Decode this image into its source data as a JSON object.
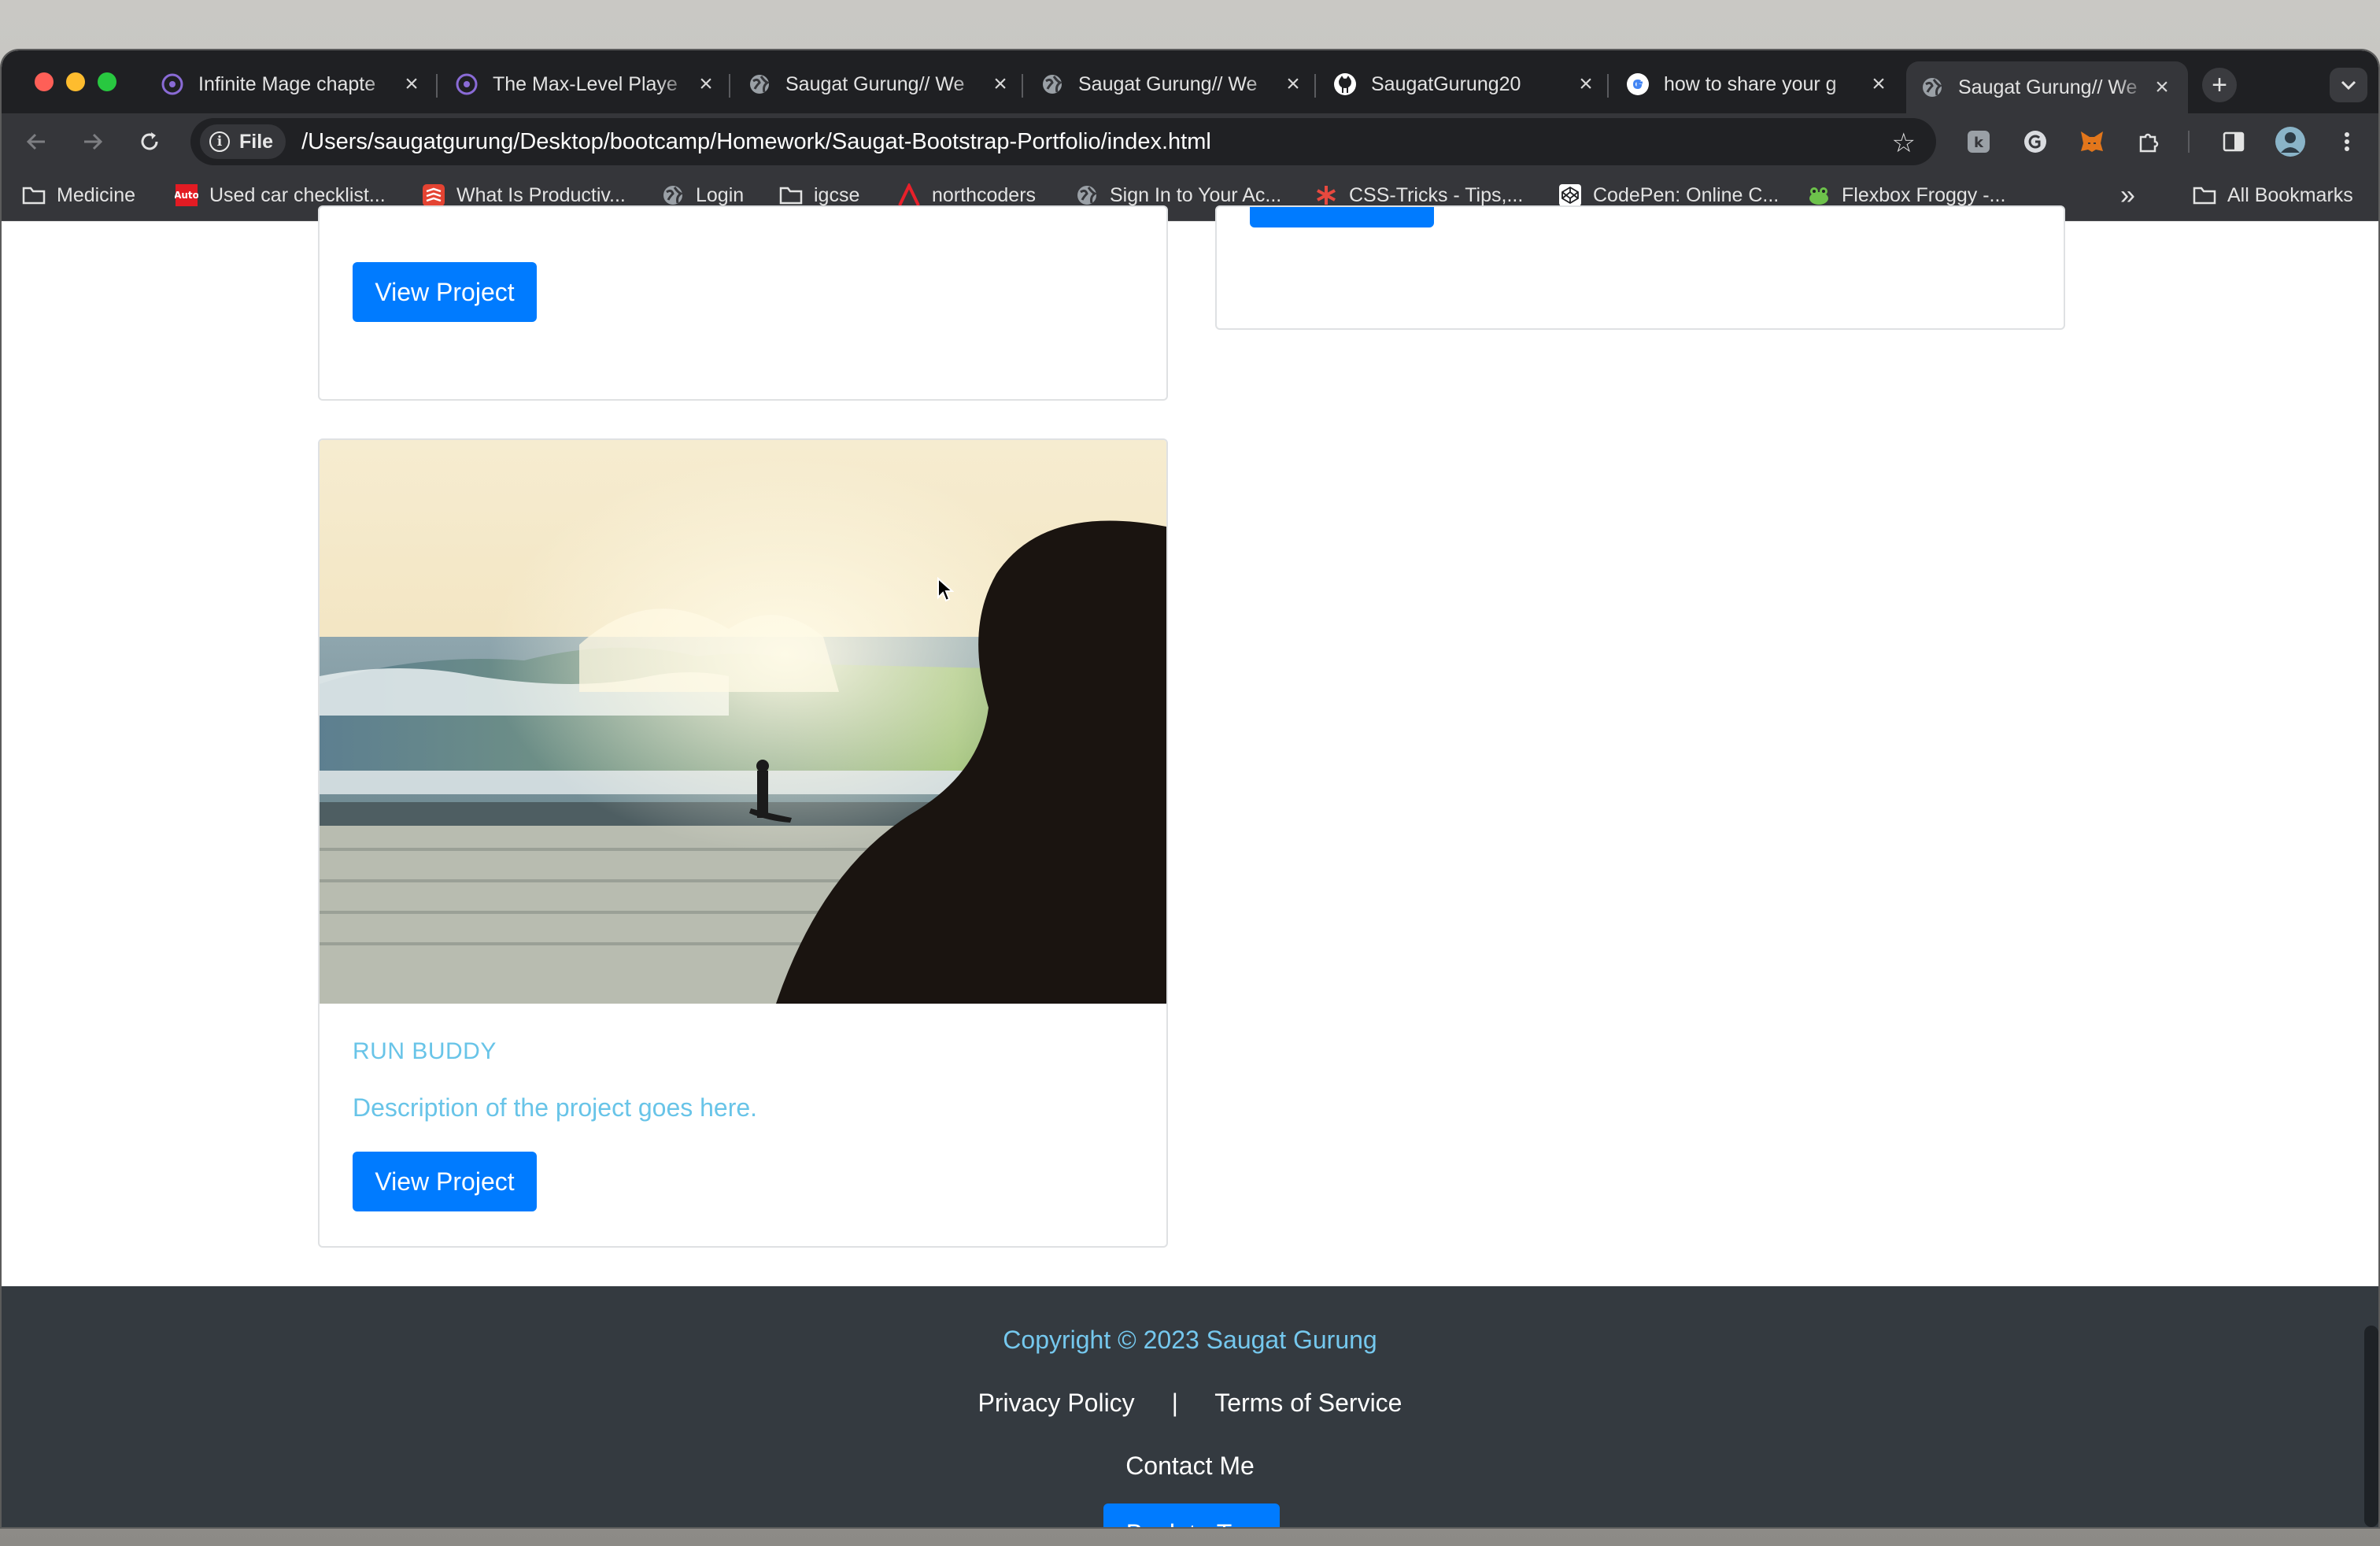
{
  "browser": {
    "tabs": [
      {
        "title": "Infinite Mage chapte",
        "icon": "mage-site-icon"
      },
      {
        "title": "The Max-Level Playe",
        "icon": "mage-site-icon"
      },
      {
        "title": "Saugat Gurung// We",
        "icon": "globe-icon"
      },
      {
        "title": "Saugat Gurung// We",
        "icon": "globe-icon"
      },
      {
        "title": "SaugatGurung20",
        "icon": "github-icon"
      },
      {
        "title": "how to share your g",
        "icon": "google-icon"
      },
      {
        "title": "Saugat Gurung// We",
        "icon": "globe-icon",
        "active": true
      }
    ],
    "new_tab_label": "+",
    "omnibox": {
      "chip_label": "File",
      "url": "/Users/saugatgurung/Desktop/bootcamp/Homework/Saugat-Bootstrap-Portfolio/index.html"
    },
    "bookmarks": [
      {
        "label": "Medicine",
        "icon": "folder-icon"
      },
      {
        "label": "Used car checklist...",
        "icon": "autoexpress-icon"
      },
      {
        "label": "What Is Productiv...",
        "icon": "todoist-icon"
      },
      {
        "label": "Login",
        "icon": "globe-icon"
      },
      {
        "label": "igcse",
        "icon": "folder-icon"
      },
      {
        "label": "northcoders",
        "icon": "northcoders-icon"
      },
      {
        "label": "Sign In to Your Ac...",
        "icon": "globe-icon"
      },
      {
        "label": "CSS-Tricks - Tips,...",
        "icon": "csstricks-icon"
      },
      {
        "label": "CodePen: Online C...",
        "icon": "codepen-icon"
      },
      {
        "label": "Flexbox Froggy -...",
        "icon": "frog-icon"
      }
    ],
    "overflow_label": "»",
    "all_bookmarks_label": "All Bookmarks"
  },
  "page": {
    "top_card": {
      "button_label": "View Project"
    },
    "project_card": {
      "title": "RUN BUDDY",
      "description": "Description of the project goes here.",
      "button_label": "View Project"
    },
    "footer": {
      "copyright": "Copyright © 2023 Saugat Gurung",
      "privacy_label": "Privacy Policy",
      "separator": "|",
      "terms_label": "Terms of Service",
      "contact_label": "Contact Me",
      "back_to_top_label": "Back to Top"
    }
  },
  "colors": {
    "primary": "#007bff",
    "card_text": "#68c4e8",
    "footer_bg": "#343a40",
    "copyright": "#75c8ee"
  }
}
